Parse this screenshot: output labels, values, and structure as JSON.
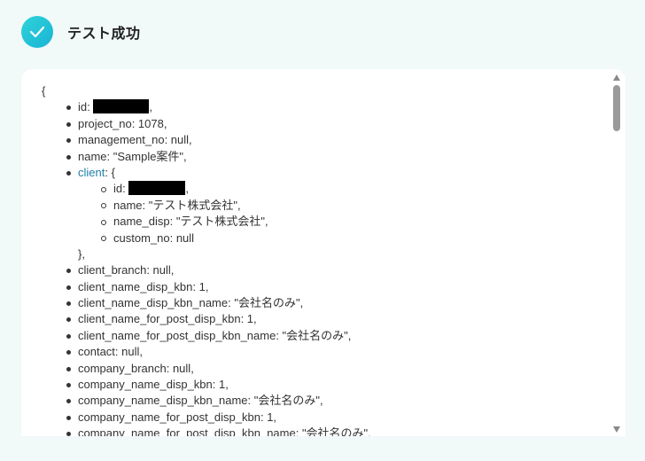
{
  "header": {
    "icon": "check-icon",
    "title": "テスト成功",
    "accent_color": "#22c3d8"
  },
  "json_view": {
    "open_brace": "{",
    "id_label": "id: ",
    "id_suffix": ",",
    "project_no": "project_no: 1078,",
    "management_no": "management_no: null,",
    "name": "name: \"Sample案件\",",
    "client_key": "client",
    "client_open": ": {",
    "client": {
      "id_label": "id: ",
      "id_suffix": ",",
      "name": "name: \"テスト株式会社\",",
      "name_disp": "name_disp: \"テスト株式会社\",",
      "custom_no": "custom_no: null"
    },
    "client_close": "},",
    "rest": [
      "client_branch: null,",
      "client_name_disp_kbn: 1,",
      "client_name_disp_kbn_name: \"会社名のみ\",",
      "client_name_for_post_disp_kbn: 1,",
      "client_name_for_post_disp_kbn_name: \"会社名のみ\",",
      "contact: null,",
      "company_branch: null,",
      "company_name_disp_kbn: 1,",
      "company_name_disp_kbn_name: \"会社名のみ\",",
      "company_name_for_post_disp_kbn: 1,",
      "company_name_for_post_disp_kbn_name: \"会社名のみ\","
    ]
  }
}
